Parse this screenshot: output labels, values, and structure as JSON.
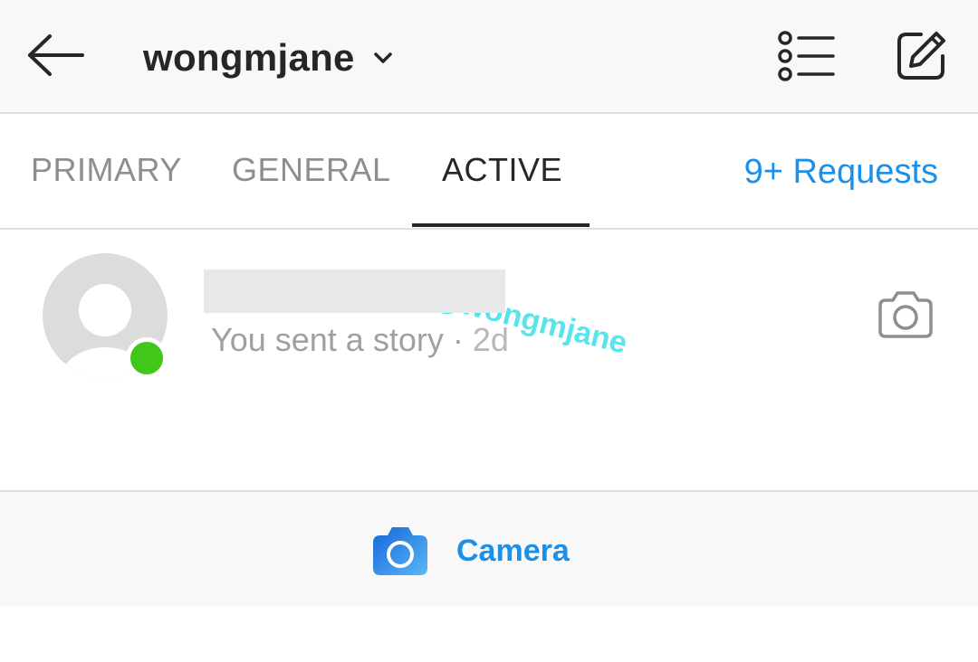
{
  "header": {
    "back_icon": "arrow-left-icon",
    "username": "wongmjane",
    "dropdown_icon": "chevron-down-icon",
    "list_icon": "list-icon",
    "compose_icon": "new-message-icon"
  },
  "tabs": {
    "items": [
      {
        "label": "PRIMARY"
      },
      {
        "label": "GENERAL"
      },
      {
        "label": "ACTIVE"
      }
    ],
    "selected": "ACTIVE",
    "requests_label": "9+ Requests",
    "watermark": "@wongmjane"
  },
  "thread": {
    "avatar_icon": "default-avatar-icon",
    "online": true,
    "preview_text": "You sent a story",
    "separator": "·",
    "time": "2d",
    "camera_icon": "camera-outline-icon"
  },
  "bottom_bar": {
    "camera_icon": "camera-filled-icon",
    "camera_label": "Camera"
  },
  "colors": {
    "accent": "#1a90ea",
    "online": "#42c61a",
    "text_primary": "#262626",
    "text_secondary": "#8e8e8e",
    "watermark": "#3ae0e8"
  }
}
